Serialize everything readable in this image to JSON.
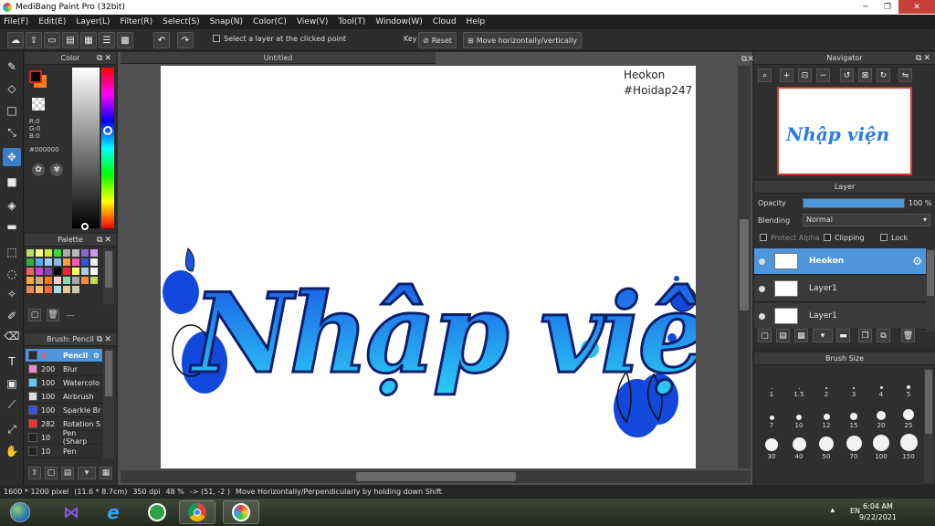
{
  "window": {
    "title": "MediBang Paint Pro (32bit)"
  },
  "menu": [
    "File(F)",
    "Edit(E)",
    "Layer(L)",
    "Filter(R)",
    "Select(S)",
    "Snap(N)",
    "Color(C)",
    "View(V)",
    "Tool(T)",
    "Window(W)",
    "Cloud",
    "Help"
  ],
  "toolbar": {
    "select_layer_label": "Select a layer at the clicked point",
    "key_label": "Key",
    "reset_label": "Reset",
    "move_label": "Move horizontally/vertically"
  },
  "color_panel": {
    "title": "Color",
    "r": "R:0",
    "g": "G:0",
    "b": "B:0",
    "hex": "#000000",
    "foreground": "#000000",
    "background": "#f5821f"
  },
  "palette_panel": {
    "title": "Palette",
    "footer_text": "---",
    "swatches": [
      "#b7e25e",
      "#f7f781",
      "#ccee33",
      "#33dd33",
      "#aaaaaa",
      "#bbbbbb",
      "#8866cc",
      "#cc99ee",
      "#33aa44",
      "#55aaee",
      "#99ccff",
      "#88bbdd",
      "#ff9933",
      "#ff55aa",
      "#3355dd",
      "#eeeeee",
      "#ee6666",
      "#cc44cc",
      "#8844aa",
      "#000000",
      "#ff2233",
      "#ffff66",
      "#aaccee",
      "#ffffff",
      "#ffaa33",
      "#ccaa77",
      "#ff7711",
      "#ffcccc",
      "#88ddaa",
      "#aaaaaa",
      "#ff8844",
      "#bbdd55",
      "#ee8855",
      "#ffbb66",
      "#ff6633",
      "#aaddee",
      "#eecc88",
      "#ccccaa"
    ]
  },
  "brush_panel": {
    "title": "Brush: Pencil",
    "brushes": [
      {
        "size": "4",
        "name": "Pencil",
        "color": "#2b2b2b"
      },
      {
        "size": "200",
        "name": "Blur",
        "color": "#ee88cc"
      },
      {
        "size": "100",
        "name": "Watercolo",
        "color": "#66ccee"
      },
      {
        "size": "100",
        "name": "Airbrush",
        "color": "#dddddd"
      },
      {
        "size": "100",
        "name": "Sparkle Br",
        "color": "#3355ee"
      },
      {
        "size": "282",
        "name": "Rotation S",
        "color": "#ee3333"
      },
      {
        "size": "10",
        "name": "Pen (Sharp",
        "color": "#222222"
      },
      {
        "size": "10",
        "name": "Pen",
        "color": "#222222"
      }
    ]
  },
  "document": {
    "tab_title": "Untitled",
    "watermark_line1": "Heokon",
    "watermark_line2": "#Hoidap247",
    "artwork_text": "Nhập viện"
  },
  "navigator": {
    "title": "Navigator",
    "thumb_text": "Nhập viện"
  },
  "layer_panel": {
    "title": "Layer",
    "opacity_label": "Opacity",
    "opacity_value": "100 %",
    "opacity_fraction": 1.0,
    "blending_label": "Blending",
    "blending_value": "Normal",
    "protect_alpha_label": "Protect Alpha",
    "clipping_label": "Clipping",
    "lock_label": "Lock",
    "layers": [
      {
        "name": "Heokon",
        "selected": true
      },
      {
        "name": "Layer1",
        "selected": false
      },
      {
        "name": "Layer1",
        "selected": false
      }
    ]
  },
  "brush_size_panel": {
    "title": "Brush Size",
    "sizes": [
      "1",
      "1.5",
      "2",
      "3",
      "4",
      "5",
      "7",
      "10",
      "12",
      "15",
      "20",
      "25",
      "30",
      "40",
      "50",
      "70",
      "100",
      "150"
    ]
  },
  "status_bar": {
    "dimensions": "1600 * 1200 pixel",
    "physical": "(11.6 * 8.7cm)",
    "dpi": "350 dpi",
    "zoom": "48 %",
    "cursor": "-> (51, -2 )",
    "hint": "Move Horizontally/Perpendicularly by holding down Shift"
  },
  "taskbar": {
    "language": "EN",
    "time": "6:04 AM",
    "date": "9/22/2021"
  }
}
